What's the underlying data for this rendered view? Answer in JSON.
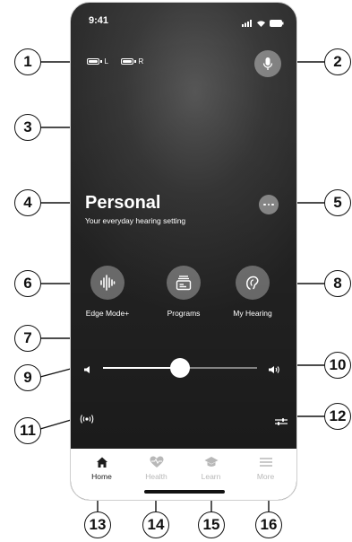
{
  "status_bar": {
    "time": "9:41"
  },
  "hearing_aids": {
    "left_label": "L",
    "right_label": "R"
  },
  "program": {
    "title": "Personal",
    "subtitle": "Your everyday hearing setting"
  },
  "actions": [
    {
      "label": "Edge Mode+",
      "icon": "waveform-icon"
    },
    {
      "label": "Programs",
      "icon": "programs-icon"
    },
    {
      "label": "My Hearing",
      "icon": "hearing-aid-icon"
    }
  ],
  "volume": {
    "level": 0.5
  },
  "tabs": [
    {
      "label": "Home",
      "icon": "home-icon",
      "active": true
    },
    {
      "label": "Health",
      "icon": "heart-pulse-icon",
      "active": false
    },
    {
      "label": "Learn",
      "icon": "graduation-cap-icon",
      "active": false
    },
    {
      "label": "More",
      "icon": "menu-icon",
      "active": false
    }
  ],
  "callouts": [
    "1",
    "2",
    "3",
    "4",
    "5",
    "6",
    "7",
    "8",
    "9",
    "10",
    "11",
    "12",
    "13",
    "14",
    "15",
    "16"
  ],
  "colors": {
    "phone_bg": "#3a3a3a",
    "active_tab": "#1d1d1d",
    "inactive_tab": "#b8b8b8"
  }
}
